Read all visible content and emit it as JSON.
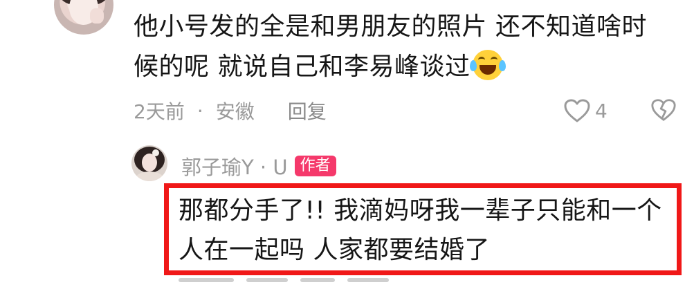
{
  "comment": {
    "line1": "他小号发的全是和男朋友的照片 还不知道啥时",
    "line2": "候的呢 就说自己和李易峰谈过",
    "emoji": "laughing-crying-emoji",
    "time": "2天前",
    "separator": "·",
    "location": "安徽",
    "reply_label": "回复",
    "like_count": "4"
  },
  "reply": {
    "author": "郭子瑜Y · U",
    "badge": "作者",
    "line1": "那都分手了!! 我滴妈呀我一辈子只能和一个",
    "line2": "人在一起吗 人家都要结婚了"
  },
  "colors": {
    "text": "#161616",
    "meta": "#9a9a9a",
    "badge": "#f5396b",
    "highlight": "#f01818"
  }
}
